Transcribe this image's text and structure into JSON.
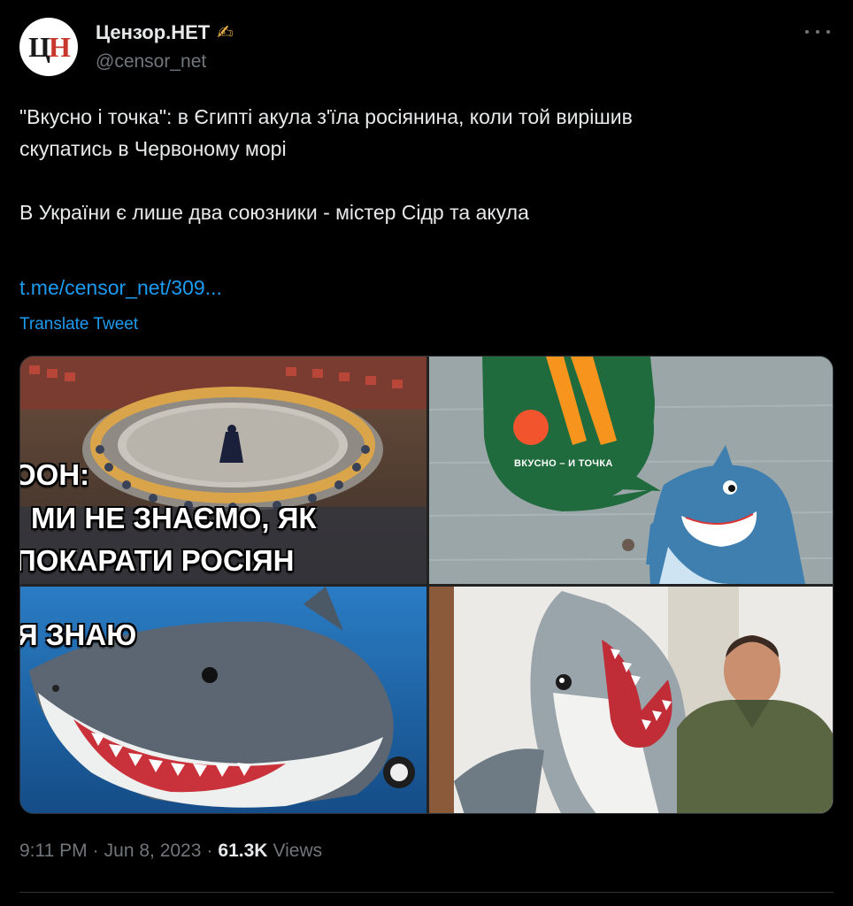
{
  "author": {
    "avatar_letters_1": "Ц",
    "avatar_letters_2": "Н",
    "display_name": "Цензор.НЕТ",
    "name_emoji": "✍",
    "handle": "@censor_net"
  },
  "tweet": {
    "line1": "\"Вкусно і точка\": в Єгипті акула з'їла росіянина, коли той вирішив",
    "line2": "скупатись в Червоному морі",
    "line3": "В України є лише два союзники - містер Сідр та акула",
    "link": "t.me/censor_net/309...",
    "translate": "Translate Tweet"
  },
  "media": {
    "meme1_line1": "ООН:",
    "meme1_line2": "МИ НЕ ЗНАЄМО, ЯК",
    "meme1_line3": "ПОКАРАТИ РОСІЯН",
    "meme2_brand": "ВКУСНО – И ТОЧКА",
    "meme3_text": "Я ЗНАЮ"
  },
  "footer": {
    "time": "9:11 PM",
    "sep1": "·",
    "date": "Jun 8, 2023",
    "sep2": "·",
    "views_count": "61.3K",
    "views_label": "Views"
  },
  "colors": {
    "background": "#000000",
    "text": "#e7e9ea",
    "muted": "#71767b",
    "link": "#1d9bf0",
    "brand_green": "#1f6b3d",
    "brand_orange": "#f26b1d"
  }
}
